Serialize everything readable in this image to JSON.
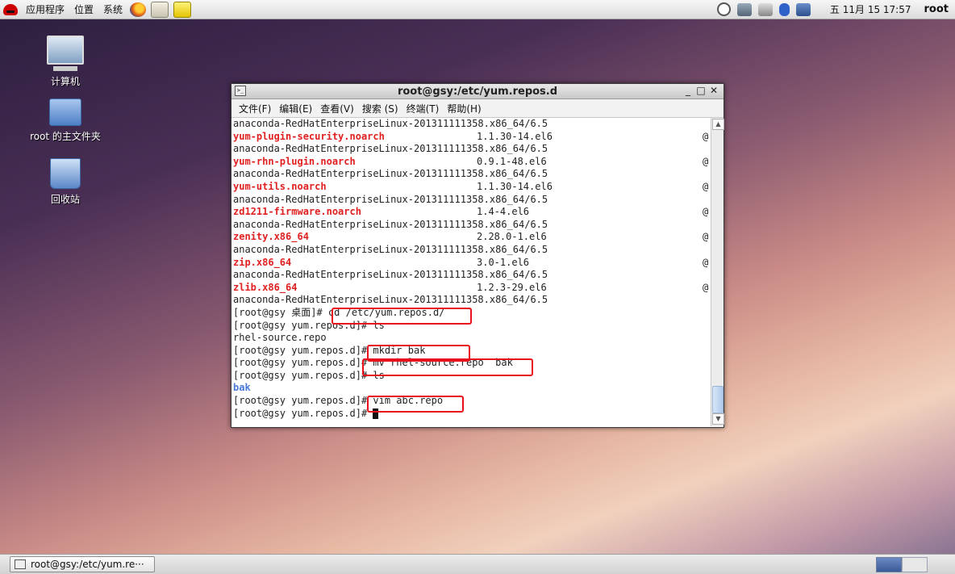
{
  "top_panel": {
    "menus": [
      "应用程序",
      "位置",
      "系统"
    ],
    "clock": "五 11月 15 17:57",
    "user": "root"
  },
  "desktop_icons": [
    {
      "label": "计算机",
      "icon": "computer-icon"
    },
    {
      "label": "root 的主文件夹",
      "icon": "home-folder-icon"
    },
    {
      "label": "回收站",
      "icon": "trash-icon"
    }
  ],
  "terminal": {
    "title": "root@gsy:/etc/yum.repos.d",
    "menus": [
      "文件(F)",
      "编辑(E)",
      "查看(V)",
      "搜索 (S)",
      "终端(T)",
      "帮助(H)"
    ],
    "lines": [
      {
        "kind": "repo",
        "text": "anaconda-RedHatEnterpriseLinux-201311111358.x86_64/6.5"
      },
      {
        "kind": "pkg",
        "name": "yum-plugin-security.noarch",
        "version": "1.1.30-14.el6",
        "at": "@"
      },
      {
        "kind": "repo",
        "text": "anaconda-RedHatEnterpriseLinux-201311111358.x86_64/6.5"
      },
      {
        "kind": "pkg",
        "name": "yum-rhn-plugin.noarch",
        "version": "0.9.1-48.el6",
        "at": "@"
      },
      {
        "kind": "repo",
        "text": "anaconda-RedHatEnterpriseLinux-201311111358.x86_64/6.5"
      },
      {
        "kind": "pkg",
        "name": "yum-utils.noarch",
        "version": "1.1.30-14.el6",
        "at": "@"
      },
      {
        "kind": "repo",
        "text": "anaconda-RedHatEnterpriseLinux-201311111358.x86_64/6.5"
      },
      {
        "kind": "pkg",
        "name": "zd1211-firmware.noarch",
        "version": "1.4-4.el6",
        "at": "@"
      },
      {
        "kind": "repo",
        "text": "anaconda-RedHatEnterpriseLinux-201311111358.x86_64/6.5"
      },
      {
        "kind": "pkg",
        "name": "zenity.x86_64",
        "version": "2.28.0-1.el6",
        "at": "@"
      },
      {
        "kind": "repo",
        "text": "anaconda-RedHatEnterpriseLinux-201311111358.x86_64/6.5"
      },
      {
        "kind": "pkg",
        "name": "zip.x86_64",
        "version": "3.0-1.el6",
        "at": "@"
      },
      {
        "kind": "repo",
        "text": "anaconda-RedHatEnterpriseLinux-201311111358.x86_64/6.5"
      },
      {
        "kind": "pkg",
        "name": "zlib.x86_64",
        "version": "1.2.3-29.el6",
        "at": "@"
      },
      {
        "kind": "repo",
        "text": "anaconda-RedHatEnterpriseLinux-201311111358.x86_64/6.5"
      },
      {
        "kind": "cmd",
        "prompt": "[root@gsy 桌面]#",
        "command": " cd /etc/yum.repos.d/"
      },
      {
        "kind": "cmd",
        "prompt": "[root@gsy yum.repos.d]#",
        "command": " ls"
      },
      {
        "kind": "out",
        "text": "rhel-source.repo"
      },
      {
        "kind": "cmd",
        "prompt": "[root@gsy yum.repos.d]#",
        "command": " mkdir bak"
      },
      {
        "kind": "cmd",
        "prompt": "[root@gsy yum.repos.d]#",
        "command": " mv rhel-source.repo  bak"
      },
      {
        "kind": "cmd",
        "prompt": "[root@gsy yum.repos.d]#",
        "command": " ls"
      },
      {
        "kind": "dir",
        "text": "bak"
      },
      {
        "kind": "cmd",
        "prompt": "[root@gsy yum.repos.d]#",
        "command": " vim abc.repo"
      },
      {
        "kind": "cmd",
        "prompt": "[root@gsy yum.repos.d]#",
        "command": " ",
        "cursor": true
      }
    ]
  },
  "taskbar": {
    "window_button": "root@gsy:/etc/yum.re···"
  },
  "colors": {
    "package_name": "#e02020",
    "directory": "#4a7ad8",
    "highlight_box": "#e8101a"
  }
}
